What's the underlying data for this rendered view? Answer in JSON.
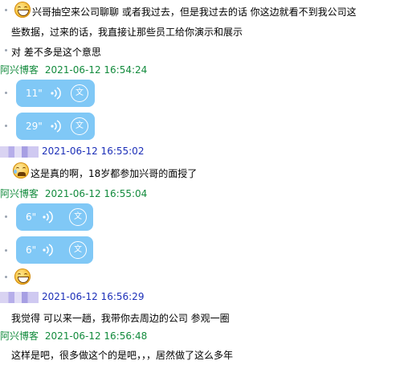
{
  "messages": {
    "m1": {
      "text": "兴哥抽空来公司聊聊  或者我过去，但是我过去的话  你这边就看不到我公司这",
      "cont": "些数据，过来的话，我直接让那些员工给你演示和展示"
    },
    "m2": {
      "text": "对  差不多是这个意思"
    },
    "h1": {
      "sender": "阿兴博客",
      "time": "2021-06-12 16:54:24"
    },
    "v1": {
      "duration": "11\"",
      "translate_icon": "文"
    },
    "v2": {
      "duration": "29\"",
      "translate_icon": "文"
    },
    "h2": {
      "time": "2021-06-12 16:55:02"
    },
    "m3": {
      "text": "这是真的啊，18岁都参加兴哥的面授了"
    },
    "h3": {
      "sender": "阿兴博客",
      "time": "2021-06-12 16:55:04"
    },
    "v3": {
      "duration": "6\"",
      "translate_icon": "文"
    },
    "v4": {
      "duration": "6\"",
      "translate_icon": "文"
    },
    "h4": {
      "time": "2021-06-12 16:56:29"
    },
    "m4": {
      "text": "我觉得  可以来一趟，我带你去周边的公司  参观一圈"
    },
    "h5": {
      "sender": "阿兴博客",
      "time": "2021-06-12 16:56:48"
    },
    "m5": {
      "text": "这样是吧，很多做这个的是吧，，，居然做了这么多年"
    }
  },
  "colors": {
    "sender": "#138b3d",
    "self_time": "#1c2fb8",
    "voice_bubble": "#80c8f6"
  }
}
